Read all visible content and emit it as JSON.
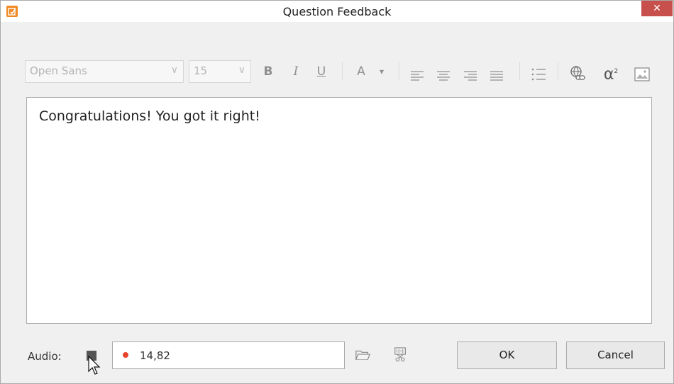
{
  "window": {
    "title": "Question Feedback",
    "close_glyph": "✕",
    "accent": "#f08a24",
    "close_color": "#c7504c"
  },
  "toolbar": {
    "font": {
      "value": "Open Sans",
      "arrow": "∨"
    },
    "size": {
      "value": "15",
      "arrow": "∨"
    },
    "bold": "B",
    "italic": "I",
    "underline": "U",
    "font_color": "A",
    "font_color_arrow": "▾",
    "icons": [
      "align-left-icon",
      "align-center-icon",
      "align-right-icon",
      "align-justify-icon",
      "bulleted-list-icon",
      "hyperlink-icon",
      "equation-icon",
      "image-icon"
    ]
  },
  "editor": {
    "text": "Congratulations! You got it right!"
  },
  "audio": {
    "label": "Audio:",
    "time": "14,82",
    "record_color": "#e8432a"
  },
  "buttons": {
    "ok": "OK",
    "cancel": "Cancel"
  }
}
